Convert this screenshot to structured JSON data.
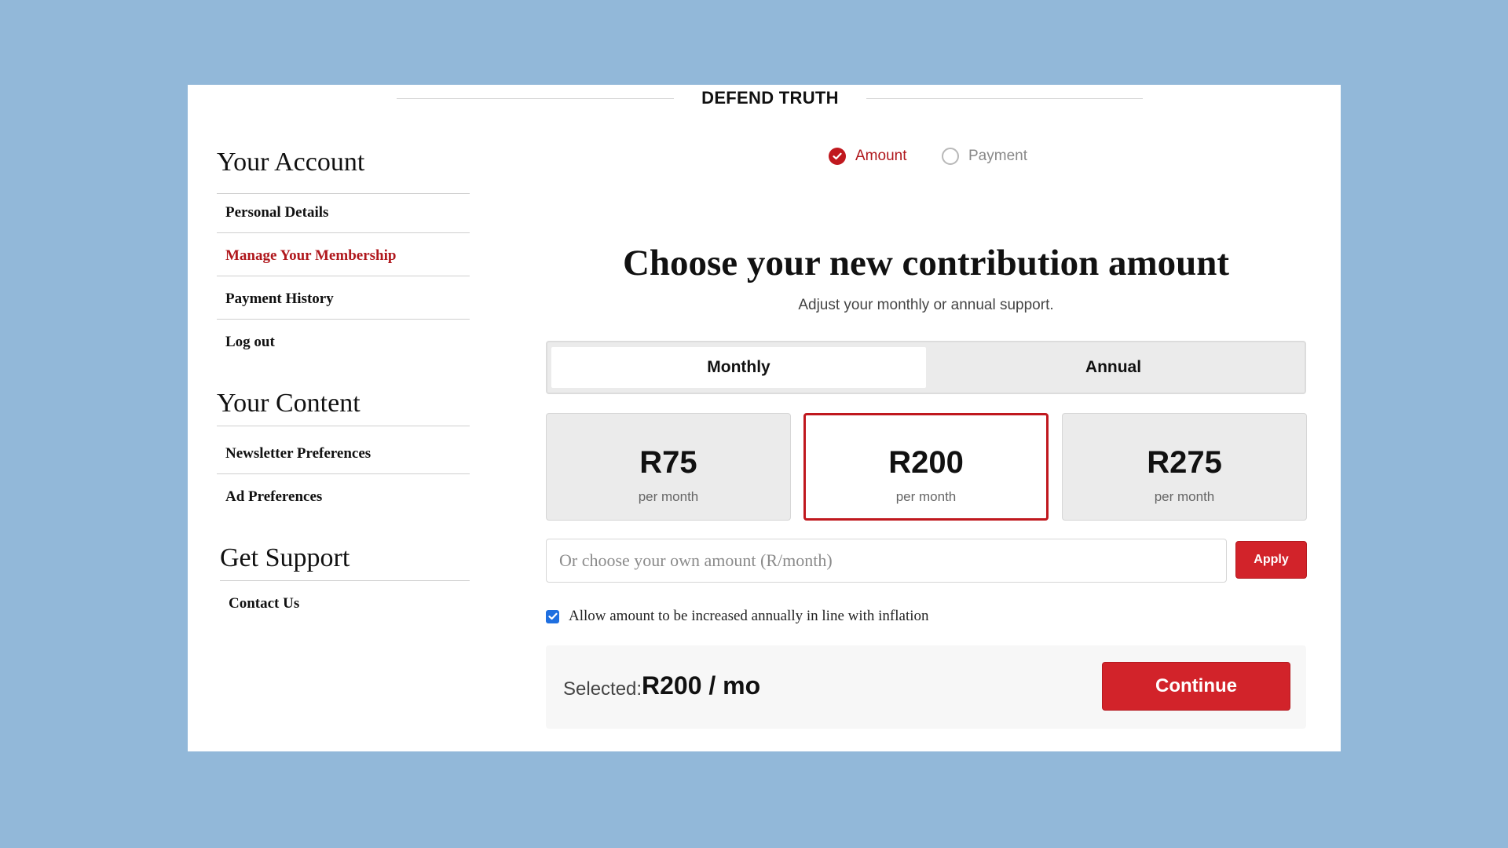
{
  "brand": {
    "name": "DEFEND TRUTH"
  },
  "sidebar": {
    "sections": [
      {
        "title": "Your Account",
        "items": [
          {
            "label": "Personal Details"
          },
          {
            "label": "Manage Your Membership",
            "active": true
          },
          {
            "label": "Payment History"
          },
          {
            "label": "Log out"
          }
        ]
      },
      {
        "title": "Your Content",
        "items": [
          {
            "label": "Newsletter Preferences"
          },
          {
            "label": "Ad Preferences"
          }
        ]
      },
      {
        "title": "Get Support",
        "items": [
          {
            "label": "Contact Us"
          }
        ]
      }
    ]
  },
  "stepper": {
    "steps": [
      {
        "label": "Amount",
        "state": "completed"
      },
      {
        "label": "Payment",
        "state": "pending"
      }
    ]
  },
  "main": {
    "title": "Choose your new contribution amount",
    "subtitle": "Adjust your monthly or annual support.",
    "frequency": {
      "options": [
        "Monthly",
        "Annual"
      ],
      "selected": "Monthly"
    },
    "amounts": [
      {
        "value": "R75",
        "period": "per month",
        "selected": false
      },
      {
        "value": "R200",
        "period": "per month",
        "selected": true
      },
      {
        "value": "R275",
        "period": "per month",
        "selected": false
      }
    ],
    "custom_amount": {
      "value": "",
      "placeholder": "Or choose your own amount (R/month)",
      "apply_label": "Apply"
    },
    "inflation": {
      "checked": true,
      "label": "Allow amount to be increased annually in line with inflation"
    },
    "summary": {
      "label": "Selected:",
      "value": "R200 / mo",
      "continue_label": "Continue"
    }
  },
  "colors": {
    "background": "#92b8d9",
    "accent_red": "#c0181e",
    "button_red": "#d2232a",
    "checkbox_blue": "#1f6fe0"
  }
}
